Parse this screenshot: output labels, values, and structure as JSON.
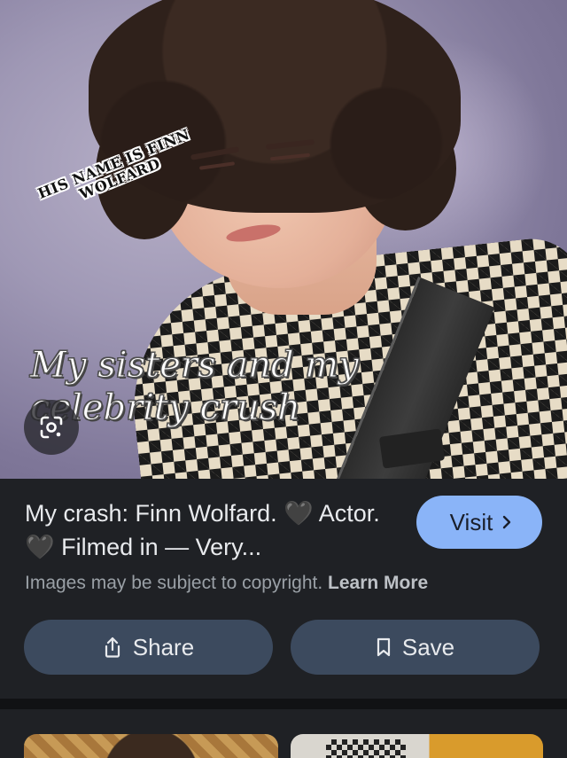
{
  "image": {
    "overlay_small_text": "HIS NAME IS FINN WOLFARD",
    "overlay_big_text": "My sisters and my celebrity crush"
  },
  "result": {
    "title": "My crash: Finn Wolfard. 🖤 Actor. 🖤 Filmed in — Very...",
    "visit_label": "Visit",
    "copyright_text": "Images may be subject to copyright.",
    "learn_more_label": "Learn More"
  },
  "actions": {
    "share_label": "Share",
    "save_label": "Save"
  },
  "icons": {
    "lens": "google-lens-icon",
    "visit_chevron": "chevron-right-icon",
    "share": "share-icon",
    "save": "bookmark-icon"
  },
  "colors": {
    "background": "#202124",
    "accent_button": "#8ab4f8",
    "action_button": "#3c4a5e",
    "primary_text": "#e8eaed",
    "secondary_text": "#9aa0a6"
  }
}
